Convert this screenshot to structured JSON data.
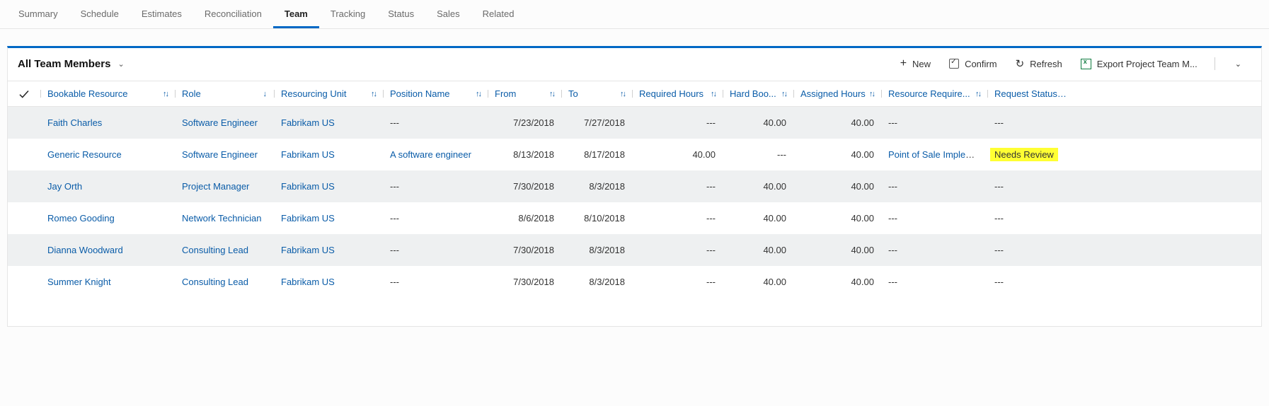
{
  "tabs": {
    "items": [
      {
        "label": "Summary",
        "active": false
      },
      {
        "label": "Schedule",
        "active": false
      },
      {
        "label": "Estimates",
        "active": false
      },
      {
        "label": "Reconciliation",
        "active": false
      },
      {
        "label": "Team",
        "active": true
      },
      {
        "label": "Tracking",
        "active": false
      },
      {
        "label": "Status",
        "active": false
      },
      {
        "label": "Sales",
        "active": false
      },
      {
        "label": "Related",
        "active": false
      }
    ]
  },
  "view": {
    "title": "All Team Members"
  },
  "toolbar": {
    "new_label": "New",
    "confirm_label": "Confirm",
    "refresh_label": "Refresh",
    "export_label": "Export Project Team M..."
  },
  "columns": {
    "resource": "Bookable Resource",
    "role": "Role",
    "unit": "Resourcing Unit",
    "pos": "Position Name",
    "from": "From",
    "to": "To",
    "req": "Required Hours",
    "hard": "Hard Boo...",
    "asg": "Assigned Hours",
    "rr": "Resource Require...",
    "status": "Request Status (..."
  },
  "rows": [
    {
      "resource": "Faith Charles",
      "role": "Software Engineer",
      "unit": "Fabrikam US",
      "pos": "---",
      "from": "7/23/2018",
      "to": "7/27/2018",
      "req": "---",
      "hard": "40.00",
      "asg": "40.00",
      "rr": "---",
      "status": "---",
      "highlight": false
    },
    {
      "resource": "Generic Resource",
      "role": "Software Engineer",
      "unit": "Fabrikam US",
      "pos": "A software engineer",
      "from": "8/13/2018",
      "to": "8/17/2018",
      "req": "40.00",
      "hard": "---",
      "asg": "40.00",
      "rr": "Point of Sale Impleme...",
      "status": "Needs Review",
      "highlight": true
    },
    {
      "resource": "Jay Orth",
      "role": "Project Manager",
      "unit": "Fabrikam US",
      "pos": "---",
      "from": "7/30/2018",
      "to": "8/3/2018",
      "req": "---",
      "hard": "40.00",
      "asg": "40.00",
      "rr": "---",
      "status": "---",
      "highlight": false
    },
    {
      "resource": "Romeo Gooding",
      "role": "Network Technician",
      "unit": "Fabrikam US",
      "pos": "---",
      "from": "8/6/2018",
      "to": "8/10/2018",
      "req": "---",
      "hard": "40.00",
      "asg": "40.00",
      "rr": "---",
      "status": "---",
      "highlight": false
    },
    {
      "resource": "Dianna Woodward",
      "role": "Consulting Lead",
      "unit": "Fabrikam US",
      "pos": "---",
      "from": "7/30/2018",
      "to": "8/3/2018",
      "req": "---",
      "hard": "40.00",
      "asg": "40.00",
      "rr": "---",
      "status": "---",
      "highlight": false
    },
    {
      "resource": "Summer Knight",
      "role": "Consulting Lead",
      "unit": "Fabrikam US",
      "pos": "---",
      "from": "7/30/2018",
      "to": "8/3/2018",
      "req": "---",
      "hard": "40.00",
      "asg": "40.00",
      "rr": "---",
      "status": "---",
      "highlight": false
    }
  ]
}
